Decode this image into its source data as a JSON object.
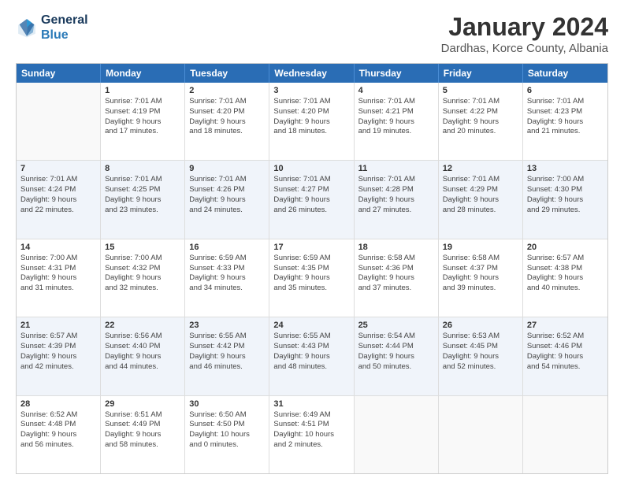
{
  "header": {
    "logo_line1": "General",
    "logo_line2": "Blue",
    "main_title": "January 2024",
    "subtitle": "Dardhas, Korce County, Albania"
  },
  "calendar": {
    "days": [
      "Sunday",
      "Monday",
      "Tuesday",
      "Wednesday",
      "Thursday",
      "Friday",
      "Saturday"
    ],
    "rows": [
      [
        {
          "day": "",
          "lines": []
        },
        {
          "day": "1",
          "lines": [
            "Sunrise: 7:01 AM",
            "Sunset: 4:19 PM",
            "Daylight: 9 hours",
            "and 17 minutes."
          ]
        },
        {
          "day": "2",
          "lines": [
            "Sunrise: 7:01 AM",
            "Sunset: 4:20 PM",
            "Daylight: 9 hours",
            "and 18 minutes."
          ]
        },
        {
          "day": "3",
          "lines": [
            "Sunrise: 7:01 AM",
            "Sunset: 4:20 PM",
            "Daylight: 9 hours",
            "and 18 minutes."
          ]
        },
        {
          "day": "4",
          "lines": [
            "Sunrise: 7:01 AM",
            "Sunset: 4:21 PM",
            "Daylight: 9 hours",
            "and 19 minutes."
          ]
        },
        {
          "day": "5",
          "lines": [
            "Sunrise: 7:01 AM",
            "Sunset: 4:22 PM",
            "Daylight: 9 hours",
            "and 20 minutes."
          ]
        },
        {
          "day": "6",
          "lines": [
            "Sunrise: 7:01 AM",
            "Sunset: 4:23 PM",
            "Daylight: 9 hours",
            "and 21 minutes."
          ]
        }
      ],
      [
        {
          "day": "7",
          "lines": [
            "Sunrise: 7:01 AM",
            "Sunset: 4:24 PM",
            "Daylight: 9 hours",
            "and 22 minutes."
          ]
        },
        {
          "day": "8",
          "lines": [
            "Sunrise: 7:01 AM",
            "Sunset: 4:25 PM",
            "Daylight: 9 hours",
            "and 23 minutes."
          ]
        },
        {
          "day": "9",
          "lines": [
            "Sunrise: 7:01 AM",
            "Sunset: 4:26 PM",
            "Daylight: 9 hours",
            "and 24 minutes."
          ]
        },
        {
          "day": "10",
          "lines": [
            "Sunrise: 7:01 AM",
            "Sunset: 4:27 PM",
            "Daylight: 9 hours",
            "and 26 minutes."
          ]
        },
        {
          "day": "11",
          "lines": [
            "Sunrise: 7:01 AM",
            "Sunset: 4:28 PM",
            "Daylight: 9 hours",
            "and 27 minutes."
          ]
        },
        {
          "day": "12",
          "lines": [
            "Sunrise: 7:01 AM",
            "Sunset: 4:29 PM",
            "Daylight: 9 hours",
            "and 28 minutes."
          ]
        },
        {
          "day": "13",
          "lines": [
            "Sunrise: 7:00 AM",
            "Sunset: 4:30 PM",
            "Daylight: 9 hours",
            "and 29 minutes."
          ]
        }
      ],
      [
        {
          "day": "14",
          "lines": [
            "Sunrise: 7:00 AM",
            "Sunset: 4:31 PM",
            "Daylight: 9 hours",
            "and 31 minutes."
          ]
        },
        {
          "day": "15",
          "lines": [
            "Sunrise: 7:00 AM",
            "Sunset: 4:32 PM",
            "Daylight: 9 hours",
            "and 32 minutes."
          ]
        },
        {
          "day": "16",
          "lines": [
            "Sunrise: 6:59 AM",
            "Sunset: 4:33 PM",
            "Daylight: 9 hours",
            "and 34 minutes."
          ]
        },
        {
          "day": "17",
          "lines": [
            "Sunrise: 6:59 AM",
            "Sunset: 4:35 PM",
            "Daylight: 9 hours",
            "and 35 minutes."
          ]
        },
        {
          "day": "18",
          "lines": [
            "Sunrise: 6:58 AM",
            "Sunset: 4:36 PM",
            "Daylight: 9 hours",
            "and 37 minutes."
          ]
        },
        {
          "day": "19",
          "lines": [
            "Sunrise: 6:58 AM",
            "Sunset: 4:37 PM",
            "Daylight: 9 hours",
            "and 39 minutes."
          ]
        },
        {
          "day": "20",
          "lines": [
            "Sunrise: 6:57 AM",
            "Sunset: 4:38 PM",
            "Daylight: 9 hours",
            "and 40 minutes."
          ]
        }
      ],
      [
        {
          "day": "21",
          "lines": [
            "Sunrise: 6:57 AM",
            "Sunset: 4:39 PM",
            "Daylight: 9 hours",
            "and 42 minutes."
          ]
        },
        {
          "day": "22",
          "lines": [
            "Sunrise: 6:56 AM",
            "Sunset: 4:40 PM",
            "Daylight: 9 hours",
            "and 44 minutes."
          ]
        },
        {
          "day": "23",
          "lines": [
            "Sunrise: 6:55 AM",
            "Sunset: 4:42 PM",
            "Daylight: 9 hours",
            "and 46 minutes."
          ]
        },
        {
          "day": "24",
          "lines": [
            "Sunrise: 6:55 AM",
            "Sunset: 4:43 PM",
            "Daylight: 9 hours",
            "and 48 minutes."
          ]
        },
        {
          "day": "25",
          "lines": [
            "Sunrise: 6:54 AM",
            "Sunset: 4:44 PM",
            "Daylight: 9 hours",
            "and 50 minutes."
          ]
        },
        {
          "day": "26",
          "lines": [
            "Sunrise: 6:53 AM",
            "Sunset: 4:45 PM",
            "Daylight: 9 hours",
            "and 52 minutes."
          ]
        },
        {
          "day": "27",
          "lines": [
            "Sunrise: 6:52 AM",
            "Sunset: 4:46 PM",
            "Daylight: 9 hours",
            "and 54 minutes."
          ]
        }
      ],
      [
        {
          "day": "28",
          "lines": [
            "Sunrise: 6:52 AM",
            "Sunset: 4:48 PM",
            "Daylight: 9 hours",
            "and 56 minutes."
          ]
        },
        {
          "day": "29",
          "lines": [
            "Sunrise: 6:51 AM",
            "Sunset: 4:49 PM",
            "Daylight: 9 hours",
            "and 58 minutes."
          ]
        },
        {
          "day": "30",
          "lines": [
            "Sunrise: 6:50 AM",
            "Sunset: 4:50 PM",
            "Daylight: 10 hours",
            "and 0 minutes."
          ]
        },
        {
          "day": "31",
          "lines": [
            "Sunrise: 6:49 AM",
            "Sunset: 4:51 PM",
            "Daylight: 10 hours",
            "and 2 minutes."
          ]
        },
        {
          "day": "",
          "lines": []
        },
        {
          "day": "",
          "lines": []
        },
        {
          "day": "",
          "lines": []
        }
      ]
    ]
  }
}
